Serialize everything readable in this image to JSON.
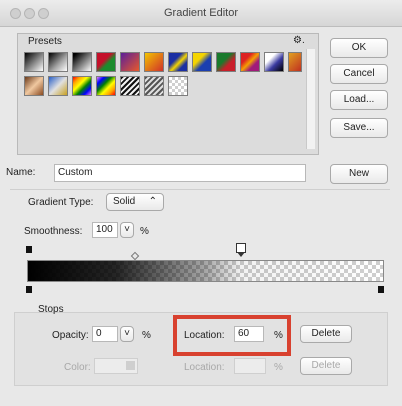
{
  "window": {
    "title": "Gradient Editor"
  },
  "presets": {
    "label": "Presets",
    "gear_glyph": "⚙."
  },
  "buttons": {
    "ok": "OK",
    "cancel": "Cancel",
    "load": "Load...",
    "save": "Save...",
    "new": "New",
    "delete": "Delete",
    "delete2": "Delete"
  },
  "name_field": {
    "label": "Name:",
    "value": "Custom"
  },
  "gradient_type": {
    "label": "Gradient Type:",
    "value": "Solid",
    "arrow": "⌃"
  },
  "smoothness": {
    "label": "Smoothness:",
    "value": "100",
    "unit": "%",
    "arrow": "˅"
  },
  "stops": {
    "label": "Stops",
    "opacity_label": "Opacity:",
    "opacity_value": "0",
    "opacity_unit": "%",
    "opacity_arrow": "˅",
    "location_label": "Location:",
    "location_value": "60",
    "location_unit": "%",
    "color_label": "Color:",
    "color_location_label": "Location:",
    "color_location_unit": "%"
  },
  "colors": {
    "highlight": "#d8412f"
  }
}
